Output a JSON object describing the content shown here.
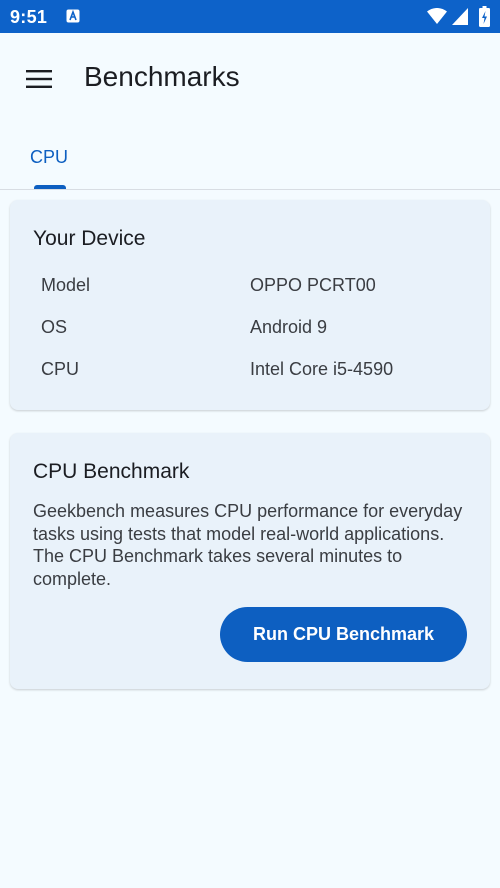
{
  "status_bar": {
    "time": "9:51",
    "notification_icon": "app-notification-icon",
    "wifi_icon": "wifi-icon",
    "signal_icon": "cellular-signal-icon",
    "battery_icon": "battery-charging-icon",
    "background_color": "#0d62c9"
  },
  "app_bar": {
    "menu_icon": "menu-icon",
    "title": "Benchmarks"
  },
  "tabs": [
    {
      "label": "CPU",
      "selected": true
    }
  ],
  "device_card": {
    "title": "Your Device",
    "specs": [
      {
        "label": "Model",
        "value": "OPPO PCRT00"
      },
      {
        "label": "OS",
        "value": "Android 9"
      },
      {
        "label": "CPU",
        "value": "Intel Core i5-4590"
      }
    ]
  },
  "benchmark_card": {
    "title": "CPU Benchmark",
    "description": "Geekbench measures CPU performance for everyday tasks using tests that model real-world applications. The CPU Benchmark takes several minutes to complete.",
    "button_label": "Run CPU Benchmark"
  },
  "colors": {
    "accent": "#0d5fc1",
    "background": "#f4fbff",
    "card_background": "#e9f2fa"
  }
}
